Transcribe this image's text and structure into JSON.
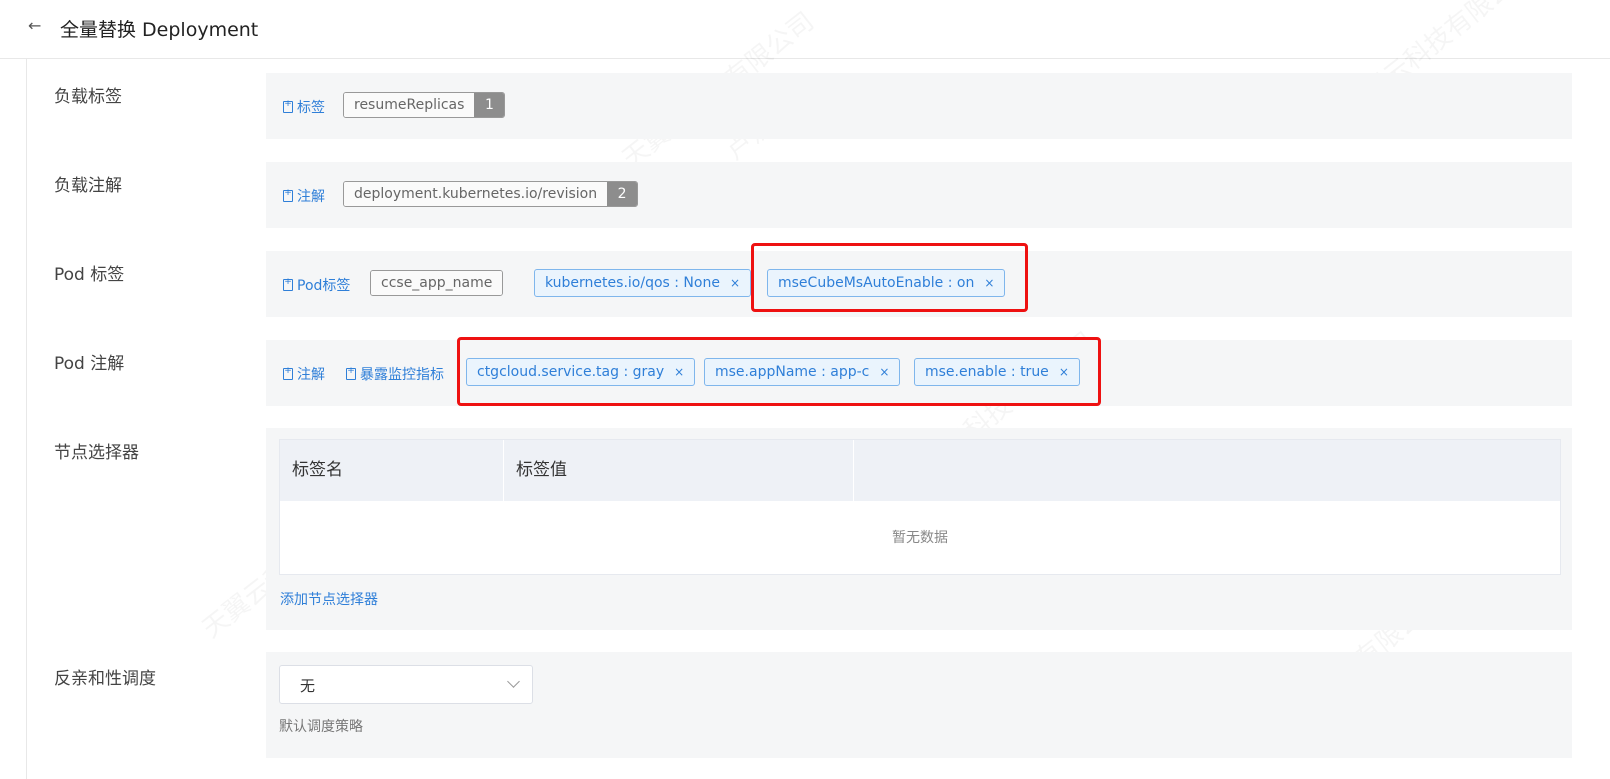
{
  "header": {
    "back_icon": "←",
    "title": "全量替换 Deployment"
  },
  "watermark": {
    "company": "天翼云科技有限公司",
    "user": "卢洪才"
  },
  "sections": {
    "workload_labels": {
      "label": "负载标签",
      "link": "标签",
      "tags": [
        {
          "text": "resumeReplicas",
          "count": "1"
        }
      ]
    },
    "workload_annotations": {
      "label": "负载注解",
      "link": "注解",
      "tags": [
        {
          "text": "deployment.kubernetes.io/revision",
          "count": "2"
        }
      ]
    },
    "pod_labels": {
      "label": "Pod 标签",
      "link": "Pod标签",
      "gray_tag": "ccse_app_name",
      "tags": [
        "kubernetes.io/qos : None",
        "mseCubeMsAutoEnable : on"
      ]
    },
    "pod_annotations": {
      "label": "Pod 注解",
      "link_annotation": "注解",
      "link_metrics": "暴露监控指标",
      "tags": [
        "ctgcloud.service.tag : gray",
        "mse.appName : app-c",
        "mse.enable : true"
      ]
    },
    "node_selector": {
      "label": "节点选择器",
      "columns": [
        "标签名",
        "标签值"
      ],
      "empty_text": "暂无数据",
      "add_link": "添加节点选择器"
    },
    "anti_affinity": {
      "label": "反亲和性调度",
      "selected": "无",
      "hint": "默认调度策略"
    }
  },
  "colors": {
    "accent": "#2f7fd8",
    "highlight": "#ee1111",
    "panel": "#f5f6f7"
  },
  "icons": {
    "close": "×",
    "doc_add": "doc-add-icon"
  }
}
